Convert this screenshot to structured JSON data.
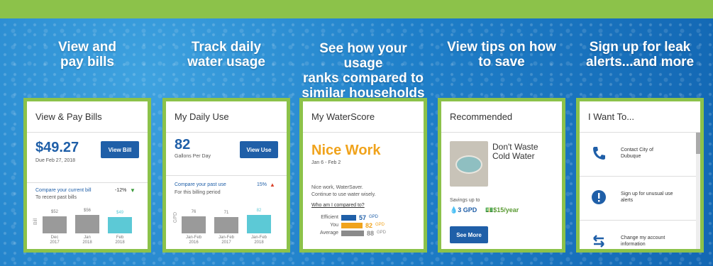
{
  "headings": [
    "View and\npay bills",
    "Track daily\nwater usage",
    "See how your usage\nranks compared to\nsimilar households",
    "View tips on how\nto save",
    "Sign up for leak\nalerts...and more"
  ],
  "bills": {
    "title": "View & Pay Bills",
    "amount": "$49.27",
    "due": "Due Feb 27, 2018",
    "button": "View Bill",
    "compare_link": "Compare your current bill",
    "change": "-12%",
    "sub": "To recent past bills",
    "axis_label": "Bill",
    "bars": [
      {
        "label": "$52",
        "tick": "Dec\n2017",
        "value": 52
      },
      {
        "label": "$56",
        "tick": "Jan\n2018",
        "value": 56
      },
      {
        "label": "$49",
        "tick": "Feb\n2018",
        "value": 49
      }
    ]
  },
  "daily": {
    "title": "My Daily Use",
    "value": "82",
    "unit": "Gallons Per Day",
    "button": "View Use",
    "compare_link": "Compare your past use",
    "change": "15%",
    "sub": "For this billing period",
    "axis_label": "GPD",
    "bars": [
      {
        "label": "76",
        "tick": "Jan-Feb\n2016",
        "value": 76
      },
      {
        "label": "71",
        "tick": "Jan-Feb\n2017",
        "value": 71
      },
      {
        "label": "82",
        "tick": "Jan-Feb\n2018",
        "value": 82
      }
    ]
  },
  "score": {
    "title": "My WaterScore",
    "headline": "Nice Work",
    "dates": "Jan 6 - Feb 2",
    "message": "Nice work, WaterSaver.\nContinue to use water wisely.",
    "link": "Who am I compared to?",
    "rows": [
      {
        "label": "Efficient",
        "value": "57",
        "unit": "GPD",
        "color": "#1f5fa8",
        "num": 57
      },
      {
        "label": "You",
        "value": "82",
        "unit": "GPD",
        "color": "#f0a31c",
        "num": 82
      },
      {
        "label": "Average",
        "value": "88",
        "unit": "GPD",
        "color": "#8a8a8a",
        "num": 88
      }
    ]
  },
  "recommended": {
    "title": "Recommended",
    "tip": "Don't Waste\nCold Water",
    "savings": "Savings up to",
    "gpd": "3 GPD",
    "money": "$15/year",
    "button": "See More"
  },
  "iwant": {
    "title": "I Want To...",
    "items": [
      {
        "label": "Contact City of\nDubuque",
        "icon": "phone-icon"
      },
      {
        "label": "Sign up for unusual use\nalerts",
        "icon": "alert-icon"
      },
      {
        "label": "Change my account\ninformation",
        "icon": "swap-arrows-icon"
      }
    ]
  },
  "colors": {
    "brand_blue": "#1f5fa8",
    "accent_green": "#8cc24a",
    "highlight": "#5cc9d6",
    "orange": "#f0a31c"
  }
}
